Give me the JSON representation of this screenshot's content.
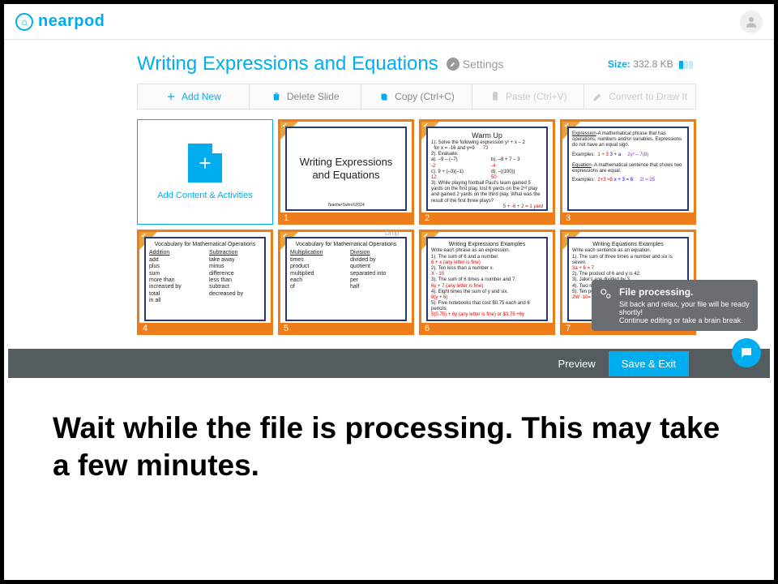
{
  "brand": "nearpod",
  "lesson_title": "Writing Expressions and Equations",
  "settings_label": "Settings",
  "size_label": "Size:",
  "size_value": "332.8 KB",
  "toolbar": {
    "add_new": "Add New",
    "delete_slide": "Delete Slide",
    "copy": "Copy (Ctrl+C)",
    "paste": "Paste (Ctrl+V)",
    "convert": "Convert to Draw It"
  },
  "add_tile_label": "Add Content & Activities",
  "drop_hint": "Drop",
  "slides": {
    "s1": {
      "num": "1",
      "title": "Writing Expressions and Equations",
      "footer": "TeacherTwins©2014"
    },
    "s2": {
      "num": "2",
      "title": "Warm Up",
      "l1": "1). Solve the following expression   y² + x – 2",
      "l1b": "for x = -16 and y=9",
      "ans1": "73",
      "l2": "2). Evaluate.",
      "a": "a).  –9 – (–7)",
      "aa": "-2",
      "b": "b).  –8 + 7 – 3",
      "ba": "-4",
      "c": "c).  9 + (–3)(–1)",
      "ca": "12",
      "d": "d).  –|(100)|",
      "da": "50",
      "l3": "3). While playing football Paul's team gained 5 yards on the first play, lost 6 yards on the 2ⁿᵈ play and gained 2 yards on the third play. What was the result of the first three plays?",
      "ans3": "5 + -6 + 2 = 1 yard"
    },
    "s3": {
      "num": "3",
      "exp_t": "Expression",
      "exp_d": "-A mathematical phrase that has operations, numbers and/or variables. Expressions do not have an equal sign.",
      "ex_l": "Examples:",
      "ex1a": "1 + 3",
      "ex1b": "3 + a",
      "ex1c": "2y² – 7(8)",
      "eq_t": "Equation",
      "eq_d": "- A mathematical sentence that shows two expressions are equal.",
      "ex2a": "2+3 =5",
      "ex2b": "x + 3 = 6",
      "ex2c": "2t = 25"
    },
    "s4": {
      "num": "4",
      "title": "Vocabulary for Mathematical Operations",
      "h1": "Addition",
      "h2": "Subtraction",
      "c1": [
        "add",
        "plus",
        "sum",
        "more than",
        "increased by",
        "total",
        "in all"
      ],
      "c2": [
        "take away",
        "minus",
        "difference",
        "less than",
        "subtract",
        "decreased by"
      ]
    },
    "s5": {
      "num": "5",
      "title": "Vocabulary for Mathematical Operations",
      "h1": "Multiplication",
      "h2": "Division",
      "c1": [
        "times",
        "product",
        "multiplied",
        "each",
        "of"
      ],
      "c2": [
        "divided by",
        "quotient",
        "separated into",
        "per",
        "half"
      ]
    },
    "s6": {
      "num": "6",
      "title": "Writing Expressions Examples",
      "sub": "Write each phrase as an expression.",
      "i1": "1). The sum of 6 and a number.",
      "a1": "6 + x (any letter is fine)",
      "i2": "2). Ten less than a number x.",
      "a2": "X - 10",
      "i3": "3). The sum of 6 times a number and 7.",
      "a3": "6y + 7  (any letter is fine)",
      "i4": "4). Eight times the sum of y and six.",
      "a4": "8(y + 6)",
      "i5": "5). Five notebooks that cost $0.75 each and 6 pencils.",
      "a5": "5(0.75) + 6y (any letter is fine)   or  $3.75 +6y"
    },
    "s7": {
      "num": "7",
      "title": "Writing Equations Examples",
      "sub": "Write each sentence as an equation.",
      "i1": "1). The sum of three times a number and six is seven.",
      "a1": "3a + 6 = 7",
      "i2": "2). The product of 6 and y is 42.",
      "i3": "3). Jake's age divided by 3",
      "i4": "4). Two more than the nu",
      "i5": "5). Ten points less than t",
      "a5": "2W -10= 90"
    }
  },
  "toast": {
    "title": "File processing.",
    "line1": "Sit back and relax, your file will be ready shortly!",
    "line2": "Continue editing or take a brain break."
  },
  "preview": "Preview",
  "save": "Save & Exit",
  "caption": "Wait while the file is processing. This may take a few minutes."
}
